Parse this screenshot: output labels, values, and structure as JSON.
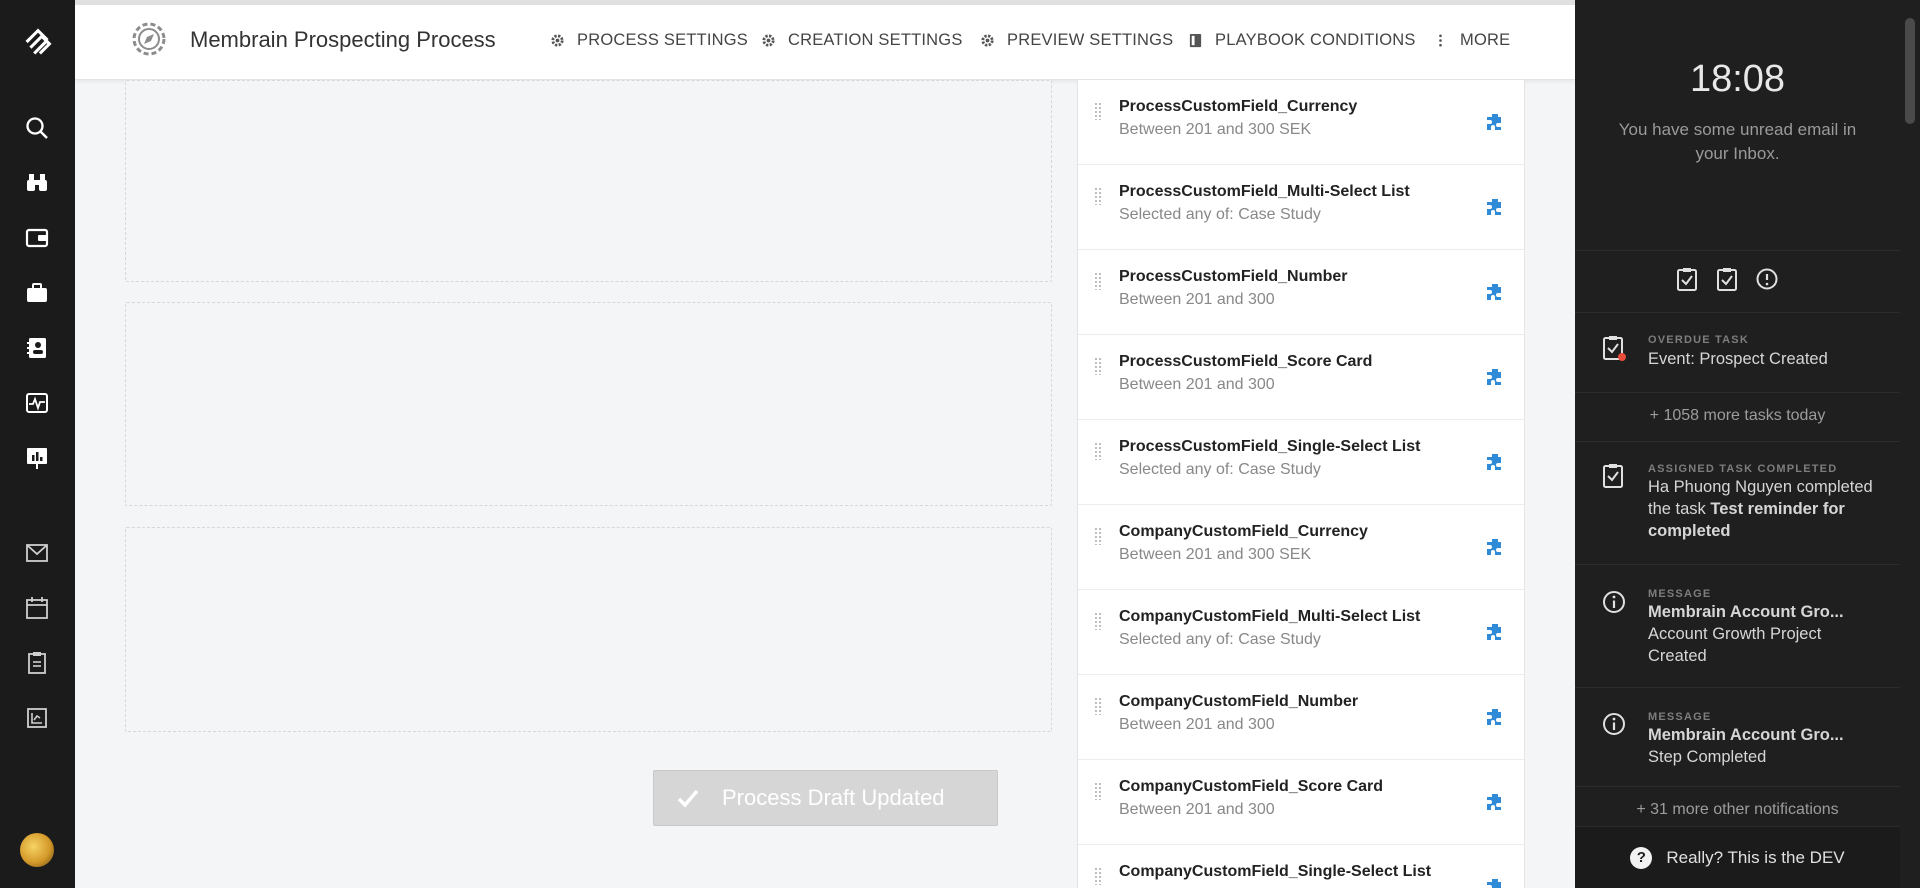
{
  "app": {
    "title": "Membrain Prospecting Process"
  },
  "nav": {
    "items": [
      "logo-icon",
      "search-icon",
      "binoculars-icon",
      "wallet-icon",
      "briefcase-icon",
      "contacts-card-icon",
      "activity-icon",
      "presentation-chart-icon",
      "mail-icon",
      "calendar-icon",
      "clipboard-icon",
      "report-icon"
    ]
  },
  "menu": {
    "process_settings": "PROCESS SETTINGS",
    "creation_settings": "CREATION SETTINGS",
    "preview_settings": "PREVIEW SETTINGS",
    "playbook_conditions": "PLAYBOOK CONDITIONS",
    "more": "MORE"
  },
  "main": {
    "update_button_label": "Process Draft Updated"
  },
  "conditions": [
    {
      "name": "ProcessCustomField_Currency",
      "desc": "Between 201 and 300 SEK"
    },
    {
      "name": "ProcessCustomField_Multi-Select List",
      "desc": "Selected any of: Case Study"
    },
    {
      "name": "ProcessCustomField_Number",
      "desc": "Between 201 and 300"
    },
    {
      "name": "ProcessCustomField_Score Card",
      "desc": "Between 201 and 300"
    },
    {
      "name": "ProcessCustomField_Single-Select List",
      "desc": "Selected any of: Case Study"
    },
    {
      "name": "CompanyCustomField_Currency",
      "desc": "Between 201 and 300 SEK"
    },
    {
      "name": "CompanyCustomField_Multi-Select List",
      "desc": "Selected any of: Case Study"
    },
    {
      "name": "CompanyCustomField_Number",
      "desc": "Between 201 and 300"
    },
    {
      "name": "CompanyCustomField_Score Card",
      "desc": "Between 201 and 300"
    },
    {
      "name": "CompanyCustomField_Single-Select List",
      "desc": ""
    }
  ],
  "right_panel": {
    "time": "18:08",
    "inbox_message": "You have some unread email in your Inbox.",
    "overdue": {
      "label": "OVERDUE TASK",
      "text": "Event: Prospect Created"
    },
    "more_tasks": "+ 1058 more tasks today",
    "assigned": {
      "label": "ASSIGNED TASK COMPLETED",
      "text_prefix": "Ha Phuong Nguyen completed the task ",
      "text_bold": "Test reminder for completed"
    },
    "message1": {
      "label": "MESSAGE",
      "title": "Membrain Account Gro...",
      "text": "Account Growth Project Created"
    },
    "message2": {
      "label": "MESSAGE",
      "title": "Membrain Account Gro...",
      "text": "Step Completed"
    },
    "more_notifications": "+ 31 more other notifications",
    "dev_text": "Really? This is the DEV"
  },
  "colors": {
    "accent_blue": "#2f8ad8",
    "dark_bg": "#1b1b1b",
    "alert_red": "#e74c3c"
  }
}
